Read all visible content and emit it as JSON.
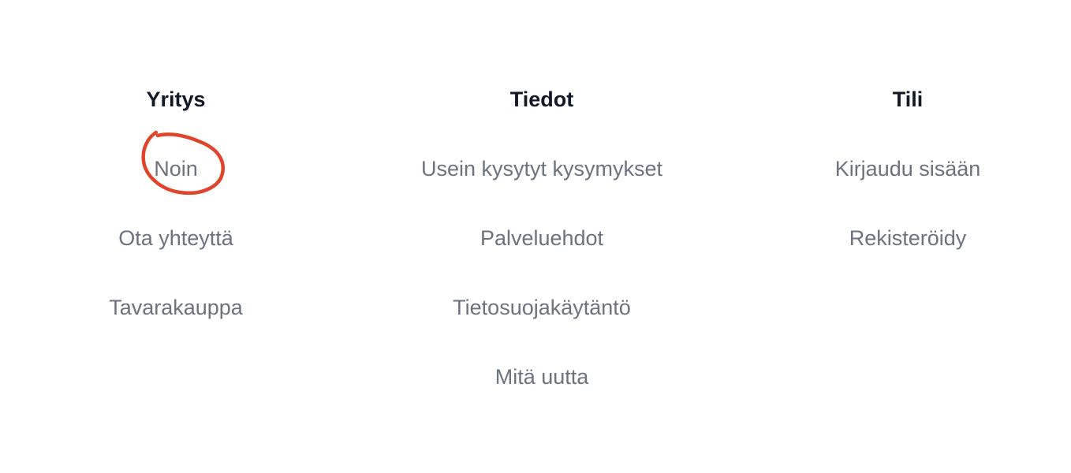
{
  "columns": [
    {
      "title": "Yritys",
      "links": [
        "Noin",
        "Ota yhteyttä",
        "Tavarakauppa"
      ]
    },
    {
      "title": "Tiedot",
      "links": [
        "Usein kysytyt kysymykset",
        "Palveluehdot",
        "Tietosuojakäytäntö",
        "Mitä uutta"
      ]
    },
    {
      "title": "Tili",
      "links": [
        "Kirjaudu sisään",
        "Rekisteröidy"
      ]
    }
  ],
  "colors": {
    "heading": "#111827",
    "link": "#6b7280",
    "annotation": "#e0442a"
  }
}
